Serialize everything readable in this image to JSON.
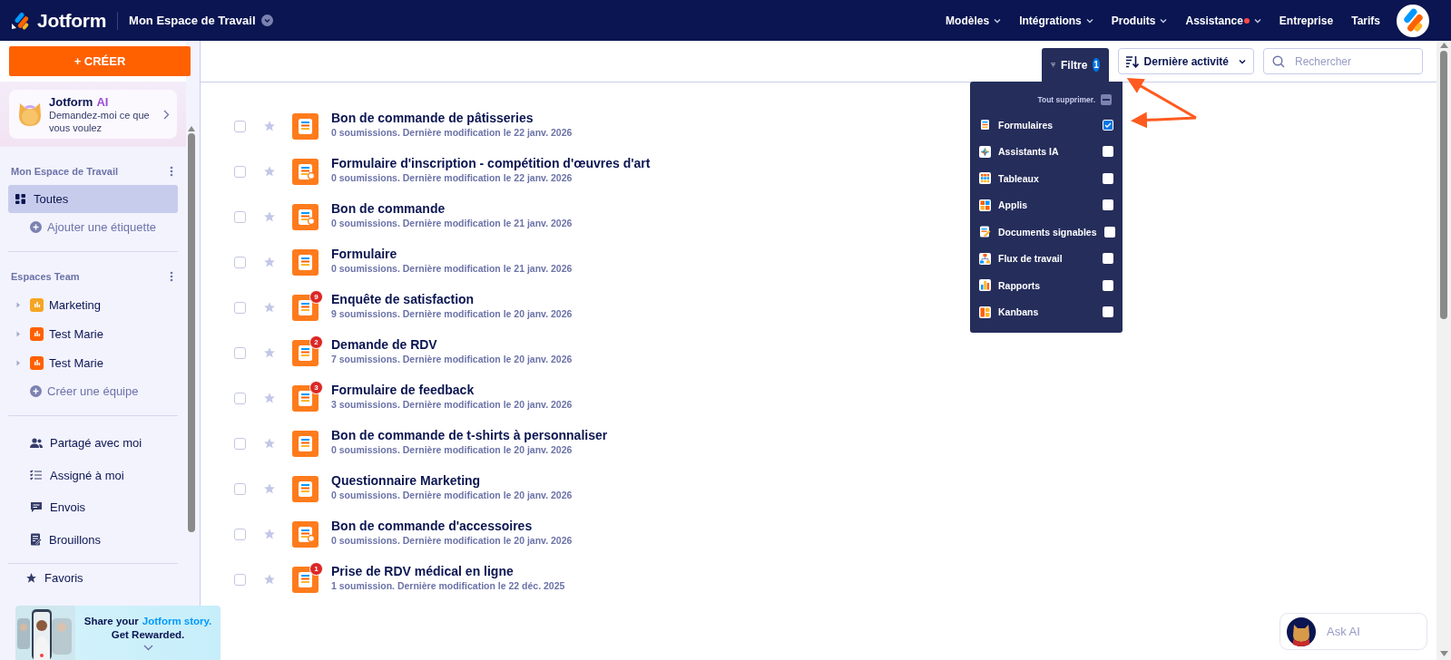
{
  "header": {
    "logo": "Jotform",
    "workspace": "Mon Espace de Travail",
    "nav": [
      {
        "label": "Modèles",
        "has_menu": true,
        "notification": false
      },
      {
        "label": "Intégrations",
        "has_menu": true,
        "notification": false
      },
      {
        "label": "Produits",
        "has_menu": true,
        "notification": false
      },
      {
        "label": "Assistance",
        "has_menu": true,
        "notification": true
      },
      {
        "label": "Entreprise",
        "has_menu": false,
        "notification": false
      },
      {
        "label": "Tarifs",
        "has_menu": false,
        "notification": false
      }
    ]
  },
  "sidebar": {
    "create_button": "+ CRÉER",
    "ai_card": {
      "title": "Jotform",
      "accent": "AI",
      "subtitle": "Demandez-moi ce que vous voulez"
    },
    "workspace": {
      "heading": "Mon Espace de Travail",
      "items": [
        {
          "label": "Toutes",
          "selected": true
        }
      ],
      "add_label": "Ajouter une étiquette"
    },
    "teams": {
      "heading": "Espaces Team",
      "items": [
        {
          "label": "Marketing",
          "color": "#f5a524"
        },
        {
          "label": "Test Marie",
          "color": "#ff6100"
        },
        {
          "label": "Test Marie",
          "color": "#ff6100"
        }
      ],
      "create_label": "Créer une équipe"
    },
    "nav": [
      {
        "label": "Partagé avec moi"
      },
      {
        "label": "Assigné à moi"
      },
      {
        "label": "Envois"
      },
      {
        "label": "Brouillons"
      }
    ],
    "favorites": "Favoris"
  },
  "toolbar": {
    "filter": {
      "label": "Filtre",
      "count": "1"
    },
    "sort": {
      "label": "Dernière activité"
    },
    "search": {
      "placeholder": "Rechercher"
    }
  },
  "filter_menu": {
    "clear": "Tout supprimer.",
    "partially_selected": true,
    "options": [
      {
        "label": "Formulaires",
        "checked": true
      },
      {
        "label": "Assistants IA",
        "checked": false
      },
      {
        "label": "Tableaux",
        "checked": false
      },
      {
        "label": "Applis",
        "checked": false
      },
      {
        "label": "Documents signables",
        "checked": false
      },
      {
        "label": "Flux de travail",
        "checked": false
      },
      {
        "label": "Rapports",
        "checked": false
      },
      {
        "label": "Kanbans",
        "checked": false
      }
    ]
  },
  "forms": [
    {
      "title": "Bon de commande de pâtisseries",
      "meta": "0 soumissions. Dernière modification le 22 janv. 2026",
      "kind": "form",
      "checked": false,
      "starred": false
    },
    {
      "title": "Formulaire d'inscription - compétition d'œuvres d'art",
      "meta": "0 soumissions. Dernière modification le 22 janv. 2026",
      "kind": "payment",
      "checked": false,
      "starred": false
    },
    {
      "title": "Bon de commande",
      "meta": "0 soumissions. Dernière modification le 21 janv. 2026",
      "kind": "payment",
      "checked": false,
      "starred": false
    },
    {
      "title": "Formulaire",
      "meta": "0 soumissions. Dernière modification le 21 janv. 2026",
      "kind": "form",
      "checked": false,
      "starred": false
    },
    {
      "title": "Enquête de satisfaction",
      "meta": "9 soumissions. Dernière modification le 20 janv. 2026",
      "kind": "form",
      "badge": "9",
      "checked": false,
      "starred": false
    },
    {
      "title": "Demande de RDV",
      "meta": "7 soumissions. Dernière modification le 20 janv. 2026",
      "kind": "form",
      "badge": "2",
      "checked": false,
      "starred": false
    },
    {
      "title": "Formulaire de feedback",
      "meta": "3 soumissions. Dernière modification le 20 janv. 2026",
      "kind": "form",
      "badge": "3",
      "checked": false,
      "starred": false
    },
    {
      "title": "Bon de commande de t-shirts à personnaliser",
      "meta": "0 soumissions. Dernière modification le 20 janv. 2026",
      "kind": "form",
      "checked": false,
      "starred": false
    },
    {
      "title": "Questionnaire Marketing",
      "meta": "0 soumissions. Dernière modification le 20 janv. 2026",
      "kind": "form",
      "checked": false,
      "starred": false
    },
    {
      "title": "Bon de commande d'accessoires",
      "meta": "0 soumissions. Dernière modification le 20 janv. 2026",
      "kind": "payment",
      "checked": false,
      "starred": false
    },
    {
      "title": "Prise de RDV médical en ligne",
      "meta": "1 soumission. Dernière modification le 22 déc. 2025",
      "kind": "form",
      "badge": "1",
      "checked": false,
      "starred": false
    }
  ],
  "promo_banner": {
    "kind": "picture",
    "line1": "Share your",
    "brand": "Jotform story.",
    "line2": "Get Rewarded."
  },
  "ask_ai": {
    "label": "Ask AI"
  }
}
